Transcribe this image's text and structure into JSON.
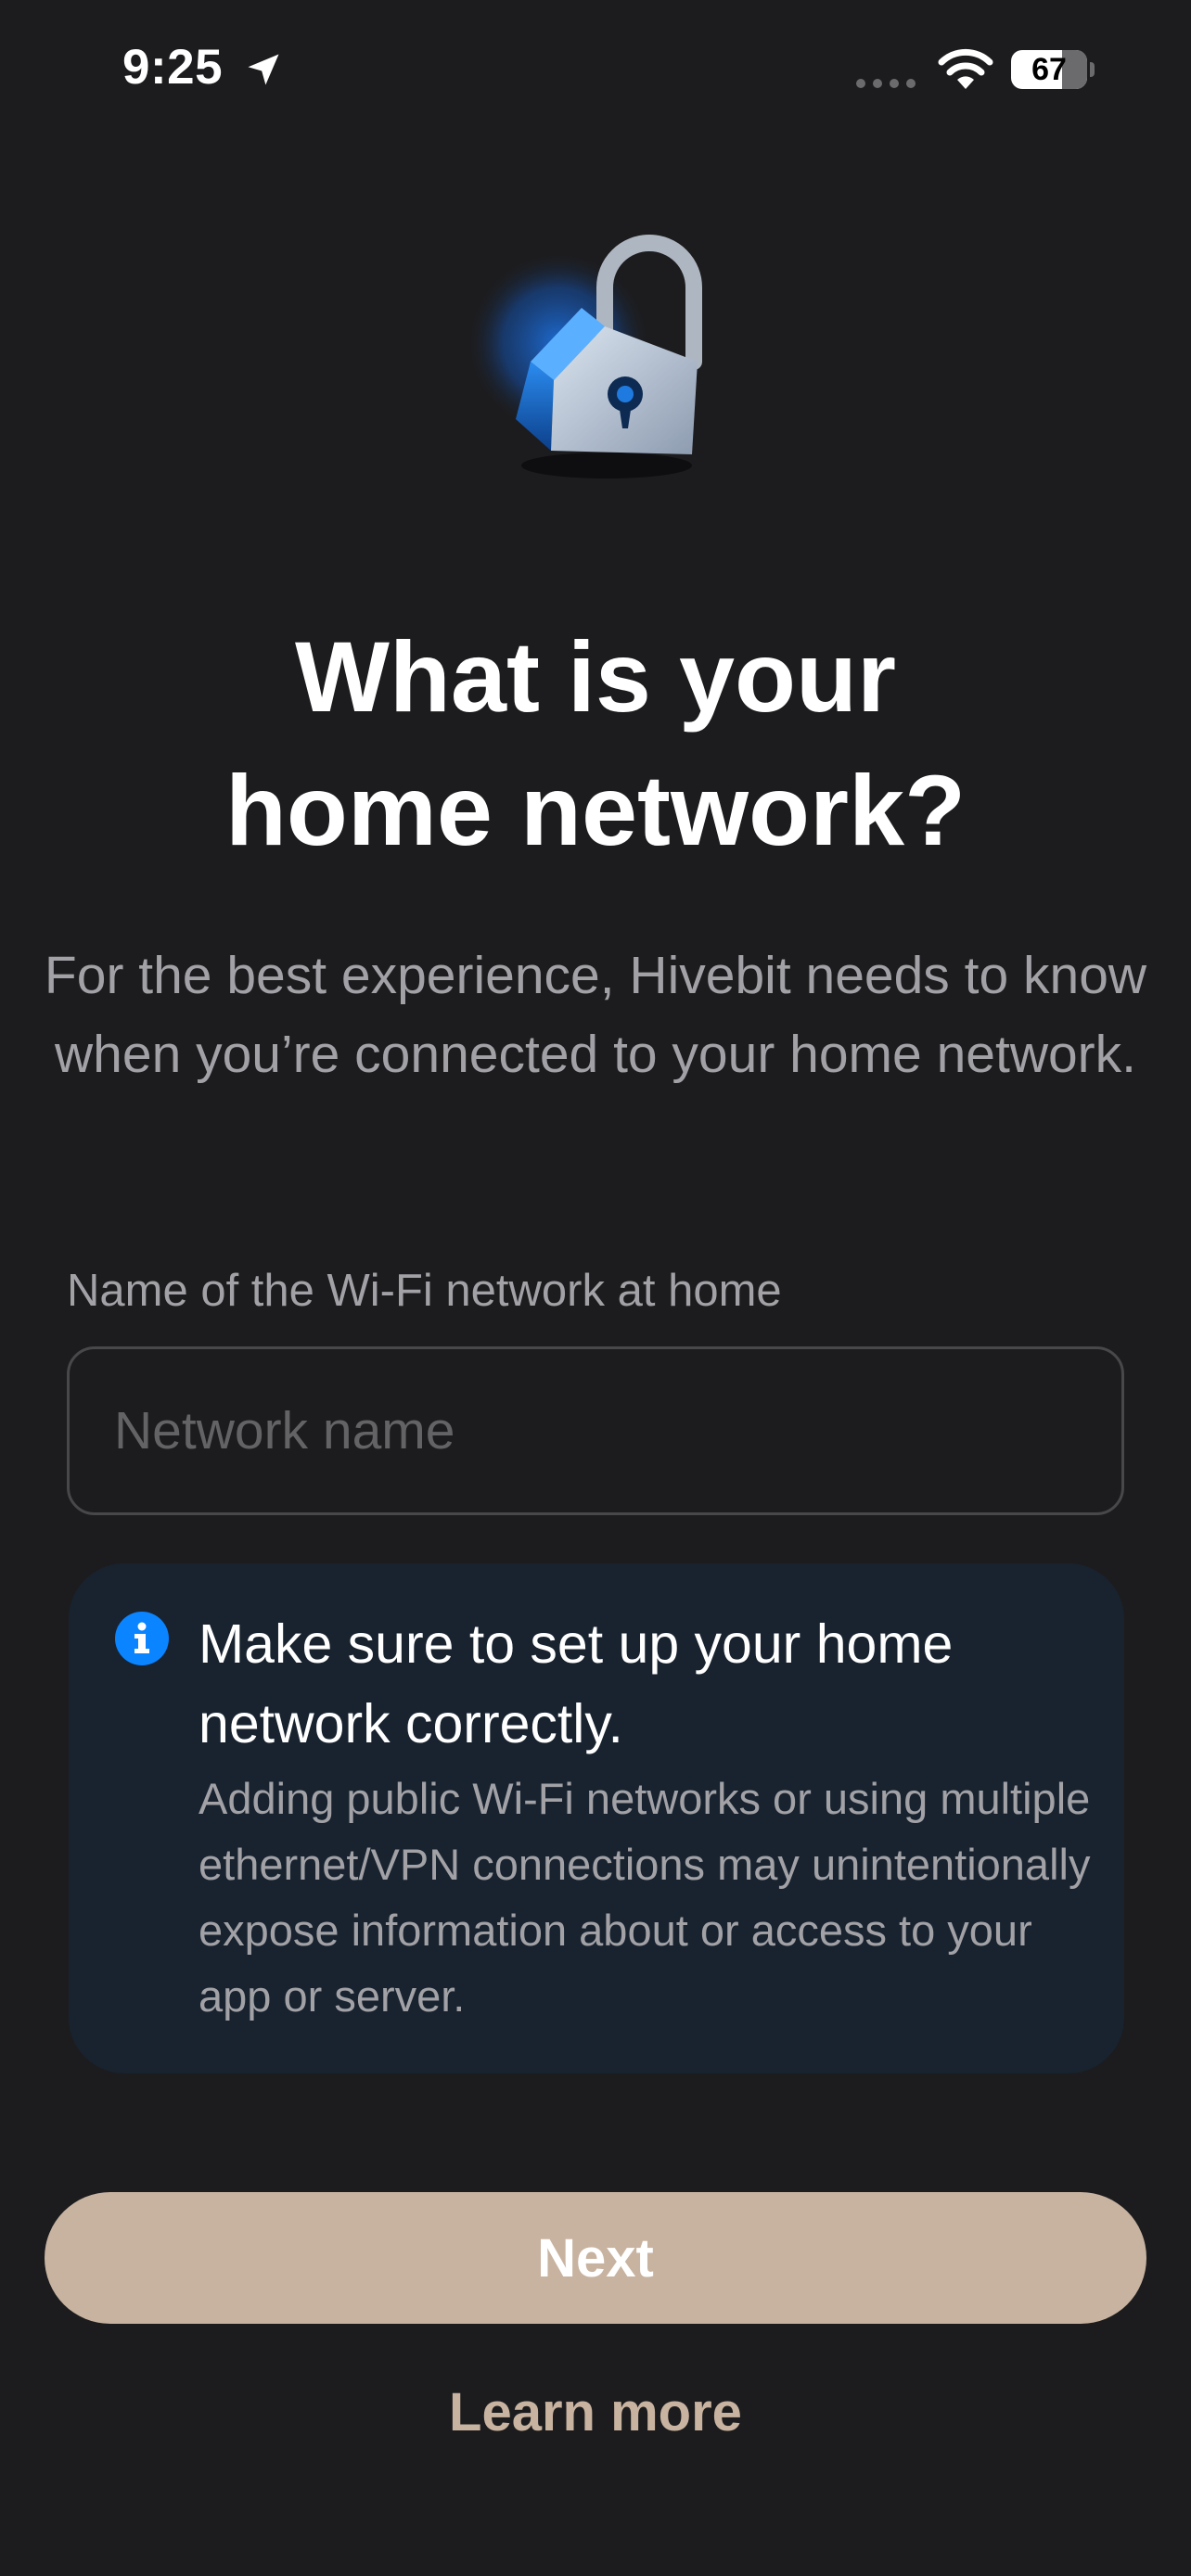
{
  "status_bar": {
    "time": "9:25",
    "battery_level": "67",
    "icons": [
      "location-arrow-icon",
      "cellular-signal-icon",
      "wifi-icon",
      "battery-icon"
    ]
  },
  "hero": {
    "icon": "padlock-icon",
    "colors": {
      "glow": "#1e6fd9",
      "lock_body": "#b9c6d6",
      "shackle": "#aeb6c2"
    }
  },
  "title": {
    "line1": "What is your",
    "line2": "home network?"
  },
  "subtitle": "For the best experience, Hivebit needs to know when you’re connected to your home network.",
  "network_field": {
    "label": "Name of the Wi-Fi network at home",
    "placeholder": "Network name",
    "value": ""
  },
  "info_card": {
    "icon": "info-icon",
    "title": "Make sure to set up your home network correctly.",
    "body": "Adding public Wi-Fi networks or using multiple ethernet/VPN connections may unintentionally expose information about or access to your app or server."
  },
  "actions": {
    "next_label": "Next",
    "learn_more_label": "Learn more"
  },
  "colors": {
    "background": "#1c1c1e",
    "accent": "#c8b3a0",
    "info_card_bg": "#18232f",
    "info_icon": "#0a84ff",
    "secondary_text": "#a1a1a6"
  }
}
